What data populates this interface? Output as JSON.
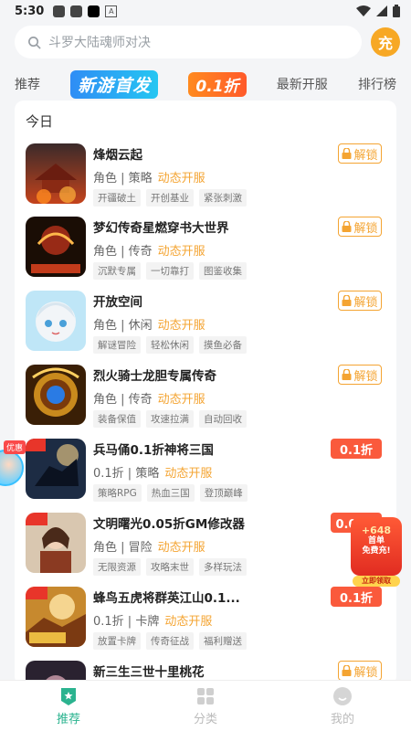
{
  "status": {
    "time": "5:30"
  },
  "search": {
    "placeholder": "斗罗大陆魂师对决"
  },
  "recharge": {
    "label": "充"
  },
  "tabs": [
    {
      "label": "推荐"
    },
    {
      "label": "新游首发"
    },
    {
      "label": "0.1折"
    },
    {
      "label": "最新开服"
    },
    {
      "label": "排行榜"
    }
  ],
  "section": {
    "title": "今日"
  },
  "games": [
    {
      "name": "烽烟云起",
      "meta": "角色 | 策略",
      "status": "动态开服",
      "tags": [
        "开疆破土",
        "开创基业",
        "紧张刺激"
      ],
      "action": "解锁"
    },
    {
      "name": "梦幻传奇星燃穿书大世界",
      "meta": "角色 | 传奇",
      "status": "动态开服",
      "tags": [
        "沉默专属",
        "一切靠打",
        "图鉴收集"
      ],
      "action": "解锁"
    },
    {
      "name": "开放空间",
      "meta": "角色 | 休闲",
      "status": "动态开服",
      "tags": [
        "解谜冒险",
        "轻松休闲",
        "摸鱼必备"
      ],
      "action": "解锁"
    },
    {
      "name": "烈火骑士龙胆专属传奇",
      "meta": "角色 | 传奇",
      "status": "动态开服",
      "tags": [
        "装备保值",
        "攻速拉满",
        "自动回收"
      ],
      "action": "解锁"
    },
    {
      "name": "兵马俑0.1折神将三国",
      "meta": "0.1折 | 策略",
      "status": "动态开服",
      "tags": [
        "策略RPG",
        "热血三国",
        "登顶巅峰"
      ],
      "action": "0.1折"
    },
    {
      "name": "文明曙光0.05折GM修改器",
      "meta": "角色 | 冒险",
      "status": "动态开服",
      "tags": [
        "无限资源",
        "攻略末世",
        "多样玩法"
      ],
      "action": "0.05折"
    },
    {
      "name": "蜂鸟五虎将群英江山0.1...",
      "meta": "0.1折 | 卡牌",
      "status": "动态开服",
      "tags": [
        "放置卡牌",
        "传奇征战",
        "福利赠送"
      ],
      "action": "0.1折"
    },
    {
      "name": "新三生三世十里桃花",
      "meta": "",
      "status": "",
      "tags": [],
      "action": "解锁"
    }
  ],
  "float_left": {
    "badge": "优惠"
  },
  "float_right": {
    "amount": "+648",
    "line1": "首单",
    "line2": "免费充!",
    "claim": "立即领取"
  },
  "nav": [
    {
      "label": "推荐"
    },
    {
      "label": "分类"
    },
    {
      "label": "我的"
    }
  ],
  "colors": {
    "accent_green": "#2bb38f",
    "orange": "#f4a432",
    "red": "#fa5a3c"
  }
}
